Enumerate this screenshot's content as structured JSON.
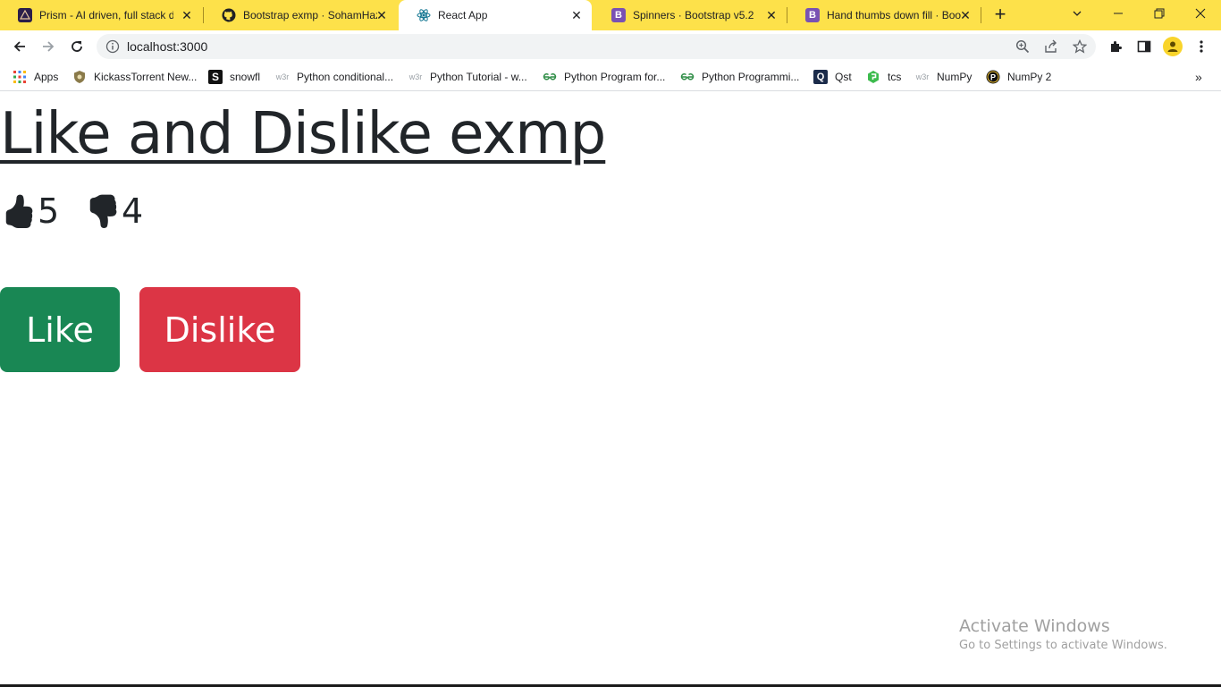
{
  "browser": {
    "tabs": [
      {
        "title": "Prism - AI driven, full stack d",
        "icon": "prism-icon",
        "active": false
      },
      {
        "title": "Bootstrap exmp · SohamHaz",
        "icon": "github-icon",
        "active": false
      },
      {
        "title": "React App",
        "icon": "react-icon",
        "active": true
      },
      {
        "title": "Spinners · Bootstrap v5.2",
        "icon": "bootstrap-icon",
        "active": false
      },
      {
        "title": "Hand thumbs down fill · Boo",
        "icon": "bootstrap-icon",
        "active": false
      }
    ],
    "address": "localhost:3000",
    "bookmarks": [
      {
        "label": "Apps",
        "icon": "apps-grid-icon"
      },
      {
        "label": "KickassTorrent New...",
        "icon": "kickass-icon"
      },
      {
        "label": "snowfl",
        "icon": "snowfl-icon"
      },
      {
        "label": "Python conditional...",
        "icon": "w3schools-icon"
      },
      {
        "label": "Python Tutorial - w...",
        "icon": "w3schools-icon"
      },
      {
        "label": "Python Program for...",
        "icon": "geeksforgeeks-icon"
      },
      {
        "label": "Python Programmi...",
        "icon": "geeksforgeeks-icon"
      },
      {
        "label": "Qst",
        "icon": "qst-icon"
      },
      {
        "label": "tcs",
        "icon": "tcs-icon"
      },
      {
        "label": "NumPy",
        "icon": "w3schools-icon"
      },
      {
        "label": "NumPy 2",
        "icon": "numpy-icon"
      }
    ],
    "colors": {
      "tabstrip": "#fde14a",
      "bootstrap_purple": "#7952b3"
    }
  },
  "page": {
    "heading": "Like and Dislike exmp",
    "likes": "5",
    "dislikes": "4",
    "like_button": "Like",
    "dislike_button": "Dislike",
    "colors": {
      "like": "#198754",
      "dislike": "#dc3545",
      "text": "#212529"
    }
  },
  "watermark": {
    "line1": "Activate Windows",
    "line2": "Go to Settings to activate Windows."
  }
}
